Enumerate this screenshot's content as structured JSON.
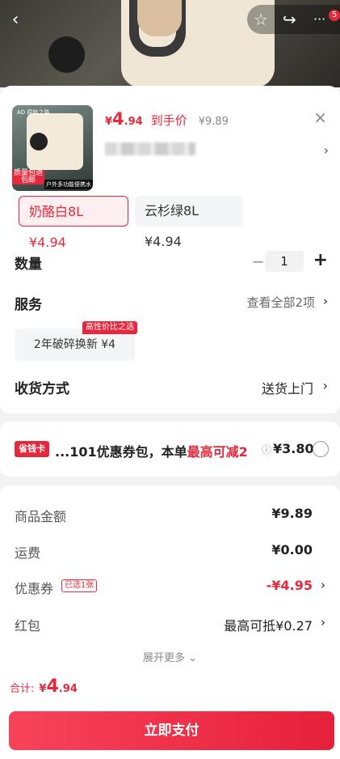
{
  "header": {
    "back_icon": "‹",
    "star_icon": "☆",
    "share_icon": "↪",
    "more_icon": "···",
    "badge_count": "5"
  },
  "product": {
    "thumbnail": {
      "brand_logo": "AD 原始之路",
      "tag_text": "质量包退 包邮",
      "caption": "户外多功能便携水袋"
    },
    "price_symbol": "¥",
    "price_int": "4",
    "price_dec": ".94",
    "price_tag": "到手价",
    "original_price": "¥9.89",
    "close_icon": "×",
    "chevron_icon": "›"
  },
  "variants": [
    {
      "label": "奶酪白8L ¥4.94",
      "selected": true
    },
    {
      "label": "云杉绿8L ¥4.94",
      "selected": false
    }
  ],
  "quantity": {
    "label": "数量",
    "minus": "−",
    "value": "1",
    "plus": "+"
  },
  "service": {
    "label": "服务",
    "view_all": "查看全部2项",
    "chevron": "›",
    "option_label": "2年破碎换新 ¥4",
    "option_badge": "高性价比之选"
  },
  "delivery": {
    "label": "收货方式",
    "value": "送货上门",
    "chevron": "›"
  },
  "coupon_pack": {
    "chip": "省钱卡",
    "text_prefix": "...101优惠券包，本单",
    "text_highlight": "最高可减2",
    "info_icon": "ⓘ",
    "amount": "¥3.80"
  },
  "summary": {
    "rows": [
      {
        "key": "商品金额",
        "value": "¥9.89"
      },
      {
        "key": "运费",
        "value": "¥0.00"
      },
      {
        "key": "优惠券",
        "pill": "已选1张",
        "value": "-¥4.95",
        "chevron": "›"
      },
      {
        "key": "红包",
        "value": "最高可抵¥0.27",
        "chevron": "›"
      }
    ],
    "expand": "展开更多 ⌄"
  },
  "footer": {
    "total_label": "合计:",
    "total_symbol": "¥",
    "total_int": "4",
    "total_dec": ".94",
    "pay_button": "立即支付"
  },
  "colors": {
    "accent": "#e6283c",
    "selected_bg": "#ffeff0",
    "muted_bg": "#f4f5f7"
  }
}
